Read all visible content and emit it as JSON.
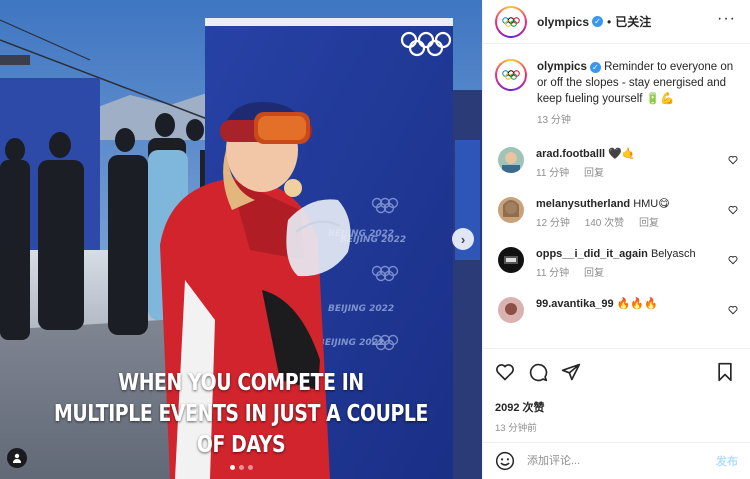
{
  "post": {
    "overlay_text_line1": "WHEN YOU COMPETE IN",
    "overlay_text_line2": "MULTIPLE EVENTS IN JUST A COUPLE OF DAYS",
    "banner_texts": [
      "BEIJING 2022",
      "BEIJING 2022",
      "BEIJING 2022",
      "BEIJING 2022"
    ],
    "carousel_count": 3,
    "carousel_active": 0
  },
  "header": {
    "username": "olympics",
    "separator": "•",
    "follow_state": "已关注"
  },
  "caption": {
    "username": "olympics",
    "text": "Reminder to everyone on or off the slopes - stay energised and keep fueling yourself 🔋💪",
    "time": "13 分钟"
  },
  "comments": [
    {
      "username": "arad.footballl",
      "text": "🖤🤙",
      "time": "11 分钟",
      "likes": "",
      "reply": "回复"
    },
    {
      "username": "melanysutherland",
      "text": "HMU😋",
      "time": "12 分钟",
      "likes": "140 次赞",
      "reply": "回复"
    },
    {
      "username": "opps__i_did_it_again",
      "text": "Belyasch",
      "time": "11 分钟",
      "likes": "",
      "reply": "回复"
    },
    {
      "username": "99.avantika_99",
      "text": "🔥🔥🔥",
      "time": "",
      "likes": "",
      "reply": ""
    }
  ],
  "actions": {
    "likes_count": "2092 次赞",
    "posted_time": "13 分钟前"
  },
  "composer": {
    "placeholder": "添加评论...",
    "post_label": "发布"
  },
  "colors": {
    "verified": "#3897f0",
    "post_disabled": "#b2dffc",
    "meta_gray": "#8e8e8e"
  },
  "icons": [
    "olympic-rings-icon",
    "verified-badge-icon",
    "more-options-icon",
    "heart-icon",
    "comment-icon",
    "share-icon",
    "bookmark-icon",
    "emoji-icon",
    "user-tag-icon",
    "chevron-right-icon"
  ]
}
